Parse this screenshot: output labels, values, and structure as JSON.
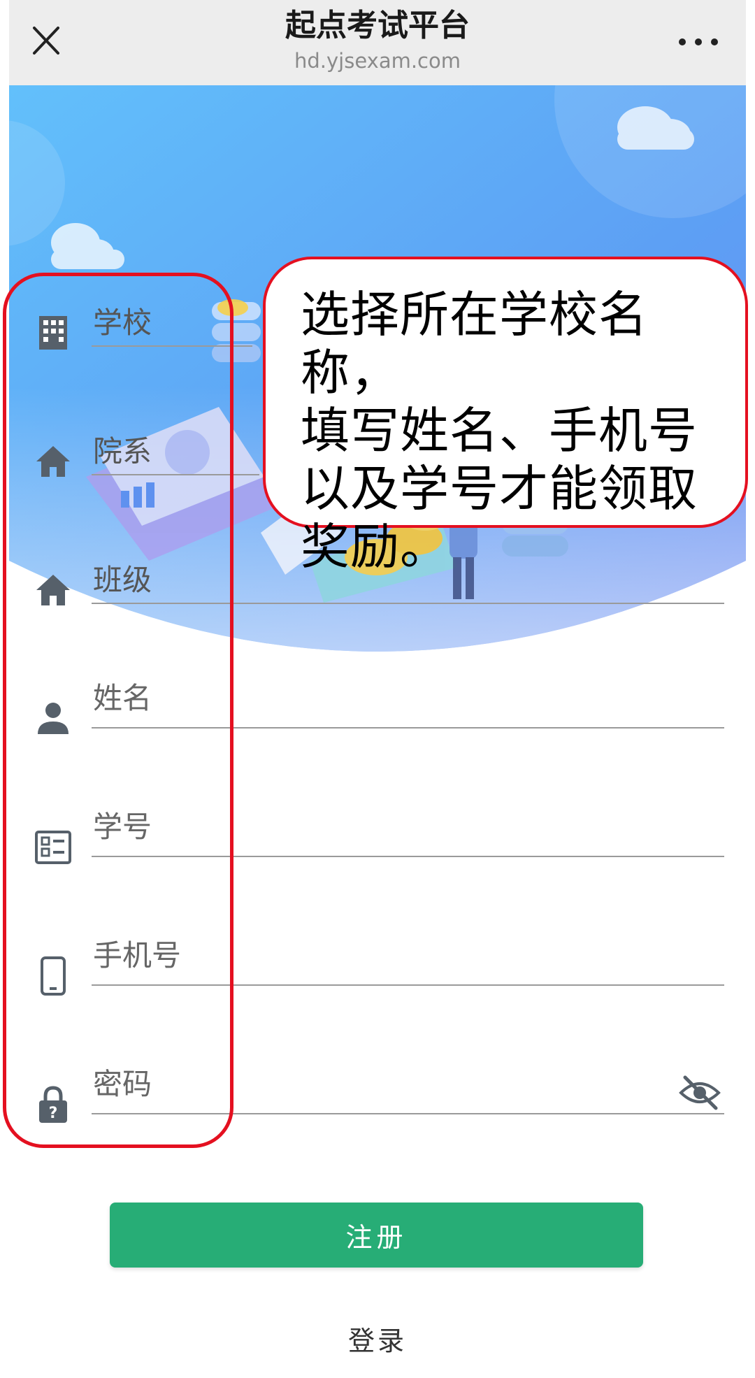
{
  "browser": {
    "title": "起点考试平台",
    "url": "hd.yjsexam.com",
    "close_icon": "close-icon",
    "more_icon": "more-dots-icon"
  },
  "form": {
    "fields": [
      {
        "label": "学校",
        "icon": "building-icon",
        "type": "select"
      },
      {
        "label": "院系",
        "icon": "home-icon",
        "type": "select"
      },
      {
        "label": "班级",
        "icon": "home-icon",
        "type": "select"
      },
      {
        "placeholder": "姓名",
        "icon": "person-icon",
        "type": "text"
      },
      {
        "placeholder": "学号",
        "icon": "id-card-icon",
        "type": "text"
      },
      {
        "placeholder": "手机号",
        "icon": "phone-icon",
        "type": "text"
      },
      {
        "placeholder": "密码",
        "icon": "lock-icon",
        "type": "password",
        "trailing_icon": "eye-off-icon"
      }
    ],
    "register_label": "注册",
    "login_label": "登录"
  },
  "annotation": {
    "callout_lines": [
      "选择所在学校名称，",
      "填写姓名、手机号",
      "以及学号才能领取",
      "奖励。"
    ]
  },
  "colors": {
    "accent_green": "#27ad76",
    "annotation_red": "#e41020",
    "icon_gray": "#555e66",
    "hero_blue": "#5aa9f5"
  }
}
